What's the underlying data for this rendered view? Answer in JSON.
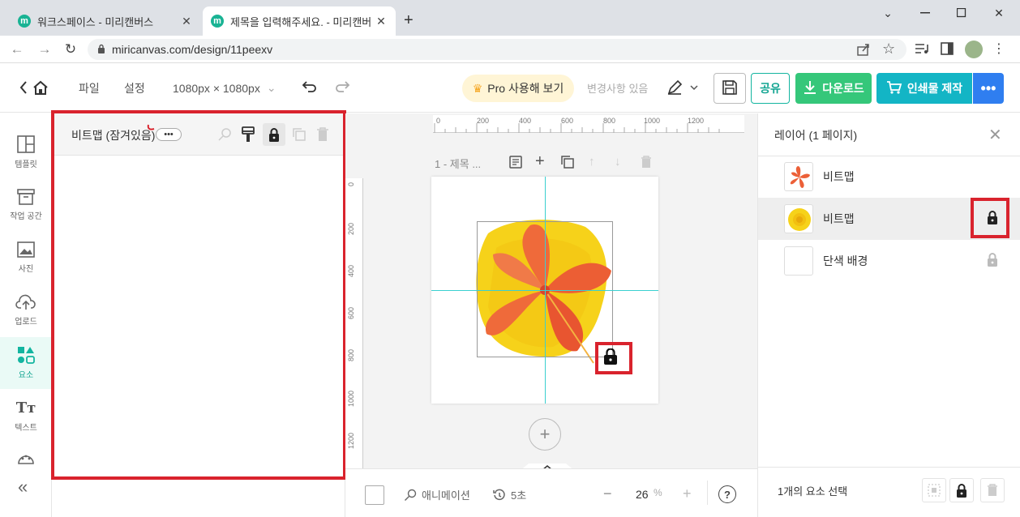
{
  "browser": {
    "tabs": [
      {
        "title": "워크스페이스 - 미리캔버스",
        "favicon": "m"
      },
      {
        "title": "제목을 입력해주세요. - 미리캔버",
        "favicon": "m"
      }
    ],
    "url": "miricanvas.com/design/11peexv"
  },
  "header": {
    "file": "파일",
    "settings": "설정",
    "size": "1080px × 1080px",
    "pro": "Pro 사용해 보기",
    "changes": "변경사항 있음",
    "share": "공유",
    "download": "다운로드",
    "print": "인쇄물 제작",
    "more": "•••"
  },
  "sidebar": {
    "items": [
      {
        "label": "템플릿",
        "icon": "template-icon"
      },
      {
        "label": "작업 공간",
        "icon": "workspace-icon"
      },
      {
        "label": "사진",
        "icon": "photo-icon"
      },
      {
        "label": "업로드",
        "icon": "upload-icon"
      },
      {
        "label": "요소",
        "icon": "elements-icon"
      },
      {
        "label": "텍스트",
        "icon": "text-icon"
      }
    ],
    "active": "요소",
    "collapse": "«"
  },
  "props": {
    "title": "비트맵 (잠겨있음)",
    "more": "•••"
  },
  "canvas": {
    "page_label": "1 - 제목 ...",
    "ruler_h": [
      "0",
      "200",
      "400",
      "600",
      "800",
      "1000",
      "1200"
    ],
    "ruler_v": [
      "0",
      "200",
      "400",
      "600",
      "800",
      "1000",
      "1200"
    ],
    "add_page": "+"
  },
  "bottom": {
    "animation": "애니메이션",
    "duration": "5초",
    "zoom": "26",
    "zoom_unit": "%"
  },
  "layers": {
    "title": "레이어 (1 페이지)",
    "items": [
      {
        "name": "비트맵",
        "thumb": "flower"
      },
      {
        "name": "비트맵",
        "thumb": "yellow-blob",
        "locked": true
      },
      {
        "name": "단색 배경",
        "thumb": "white"
      }
    ],
    "footer": "1개의 요소 선택"
  },
  "colors": {
    "accent": "#13b5a0",
    "highlight": "#d9232d",
    "guide": "#3ad0d0"
  }
}
